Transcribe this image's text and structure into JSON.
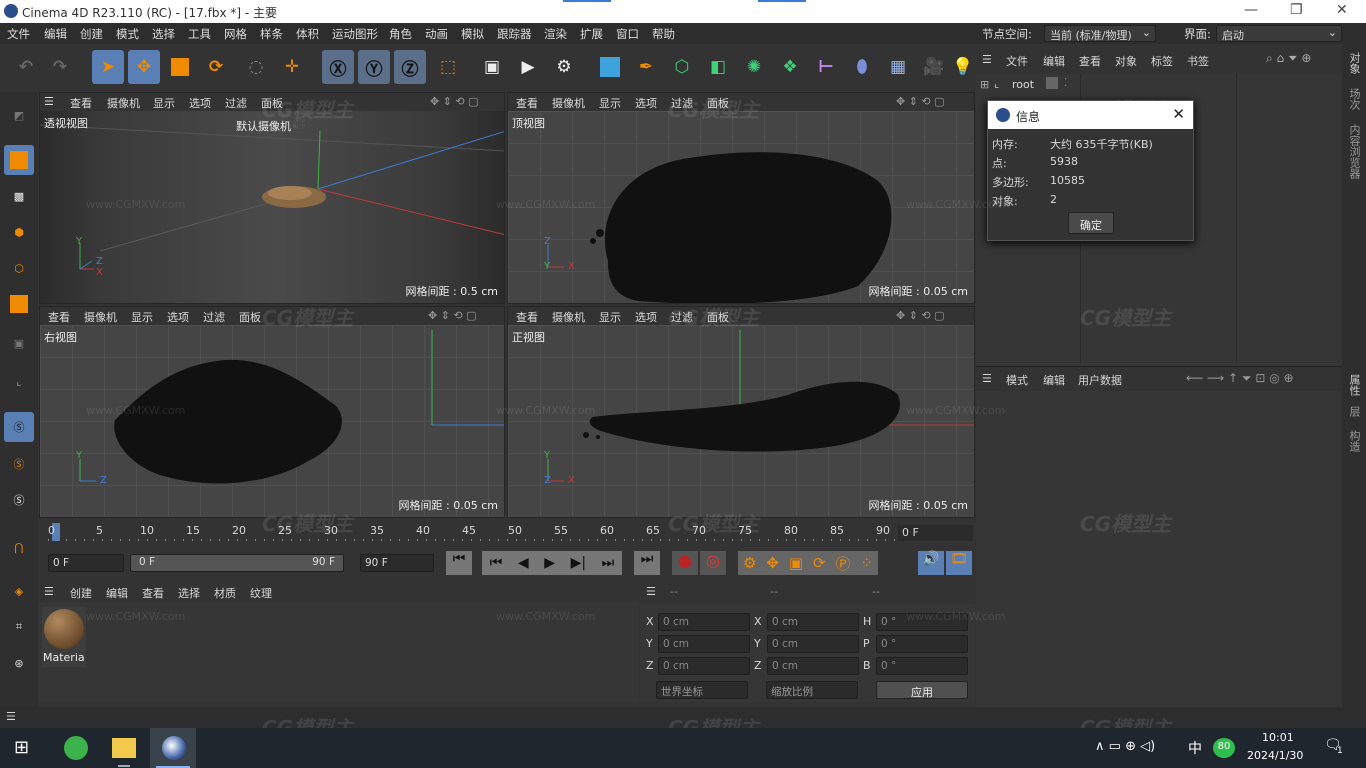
{
  "window": {
    "title": "Cinema 4D R23.110 (RC) - [17.fbx *] - 主要"
  },
  "menu": {
    "items": [
      "文件",
      "编辑",
      "创建",
      "模式",
      "选择",
      "工具",
      "网格",
      "样条",
      "体积",
      "运动图形",
      "角色",
      "动画",
      "模拟",
      "跟踪器",
      "渲染",
      "扩展",
      "窗口",
      "帮助"
    ],
    "node_space_label": "节点空间:",
    "node_space_value": "当前 (标准/物理)",
    "layout_label": "界面:",
    "layout_value": "启动"
  },
  "viewport_menu": [
    "查看",
    "摄像机",
    "显示",
    "选项",
    "过滤",
    "面板"
  ],
  "viewports": {
    "perspective": {
      "name": "透视视图",
      "camera": "默认摄像机",
      "spacing": "网格间距 : 0.5 cm"
    },
    "top": {
      "name": "顶视图",
      "spacing": "网格间距 : 0.05 cm"
    },
    "right": {
      "name": "右视图",
      "spacing": "网格间距 : 0.05 cm"
    },
    "front": {
      "name": "正视图",
      "spacing": "网格间距 : 0.05 cm"
    }
  },
  "axes": {
    "x": "X",
    "y": "Y",
    "z": "Z"
  },
  "timeline": {
    "ticks": [
      "0",
      "5",
      "10",
      "15",
      "20",
      "25",
      "30",
      "35",
      "40",
      "45",
      "50",
      "55",
      "60",
      "65",
      "70",
      "75",
      "80",
      "85",
      "90"
    ],
    "current": "0 F",
    "start": "0 F",
    "range_start": "0 F",
    "range_end": "90 F",
    "end": "90 F"
  },
  "material_panel": {
    "menu": [
      "创建",
      "编辑",
      "查看",
      "选择",
      "材质",
      "纹理"
    ],
    "material_name": "Materia"
  },
  "coord_panel": {
    "dash": "--",
    "rows": [
      {
        "a": "X",
        "av": "0 cm",
        "b": "X",
        "bv": "0 cm",
        "c": "H",
        "cv": "0 °"
      },
      {
        "a": "Y",
        "av": "0 cm",
        "b": "Y",
        "bv": "0 cm",
        "c": "P",
        "cv": "0 °"
      },
      {
        "a": "Z",
        "av": "0 cm",
        "b": "Z",
        "bv": "0 cm",
        "c": "B",
        "cv": "0 °"
      }
    ],
    "world": "世界坐标",
    "scale": "缩放比例",
    "apply": "应用"
  },
  "object_manager": {
    "menu": [
      "文件",
      "编辑",
      "查看",
      "对象",
      "标签",
      "书签"
    ],
    "root": "root"
  },
  "attribute_manager": {
    "menu": [
      "模式",
      "编辑",
      "用户数据"
    ]
  },
  "side_tabs": [
    "对象",
    "场次",
    "内容浏览器",
    "属性",
    "层",
    "构造"
  ],
  "info_dialog": {
    "title": "信息",
    "rows": [
      {
        "k": "内存:",
        "v": "大约 635千字节(KB)"
      },
      {
        "k": "点:",
        "v": "5938"
      },
      {
        "k": "多边形:",
        "v": "10585"
      },
      {
        "k": "对象:",
        "v": "2"
      }
    ],
    "ok": "确定"
  },
  "taskbar": {
    "time": "10:01",
    "date": "2024/1/30",
    "ime": "中",
    "badge": "80",
    "notify": "1"
  },
  "watermark": {
    "logo": "CG模型主",
    "url": "www.CGMXW.com"
  }
}
